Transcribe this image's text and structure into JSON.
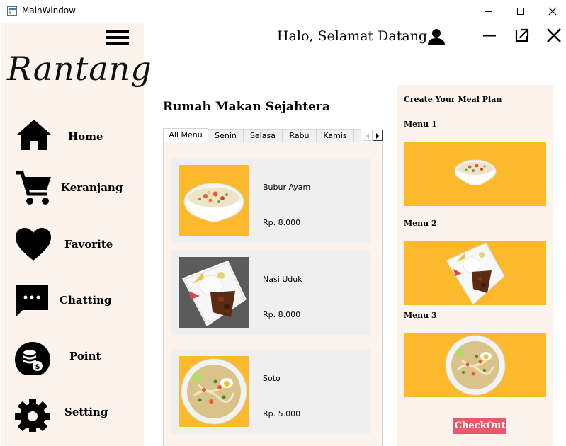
{
  "window": {
    "title": "MainWindow"
  },
  "sidebar": {
    "logo": "Rantang",
    "items": [
      {
        "label": "Home",
        "icon": "home-icon"
      },
      {
        "label": "Keranjang",
        "icon": "cart-icon"
      },
      {
        "label": "Favorite",
        "icon": "heart-icon"
      },
      {
        "label": "Chatting",
        "icon": "chat-icon"
      },
      {
        "label": "Point",
        "icon": "coins-icon"
      },
      {
        "label": "Setting",
        "icon": "gear-icon"
      }
    ]
  },
  "header": {
    "greeting": "Halo, Selamat Datang"
  },
  "restaurant": {
    "name": "Rumah Makan Sejahtera",
    "tabs": [
      "All Menu",
      "Senin",
      "Selasa",
      "Rabu",
      "Kamis"
    ],
    "active_tab": "All Menu",
    "menu": [
      {
        "name": "Bubur Ayam",
        "price": "Rp. 8.000"
      },
      {
        "name": "Nasi Uduk",
        "price": "Rp. 8.000"
      },
      {
        "name": "Soto",
        "price": "Rp. 5.000"
      }
    ]
  },
  "meal_plan": {
    "title": "Create Your Meal Plan",
    "slots": [
      {
        "label": "Menu 1",
        "dish": "Bubur Ayam"
      },
      {
        "label": "Menu 2",
        "dish": "Nasi Uduk"
      },
      {
        "label": "Menu 3",
        "dish": "Soto"
      }
    ],
    "checkout_label": "CheckOut"
  },
  "colors": {
    "panel_bg": "#fbf3ec",
    "food_bg": "#fbb92b",
    "card_bg": "#efefef",
    "checkout_bg": "#e9596a",
    "nasi_uduk_bg": "#5b5b5b"
  }
}
